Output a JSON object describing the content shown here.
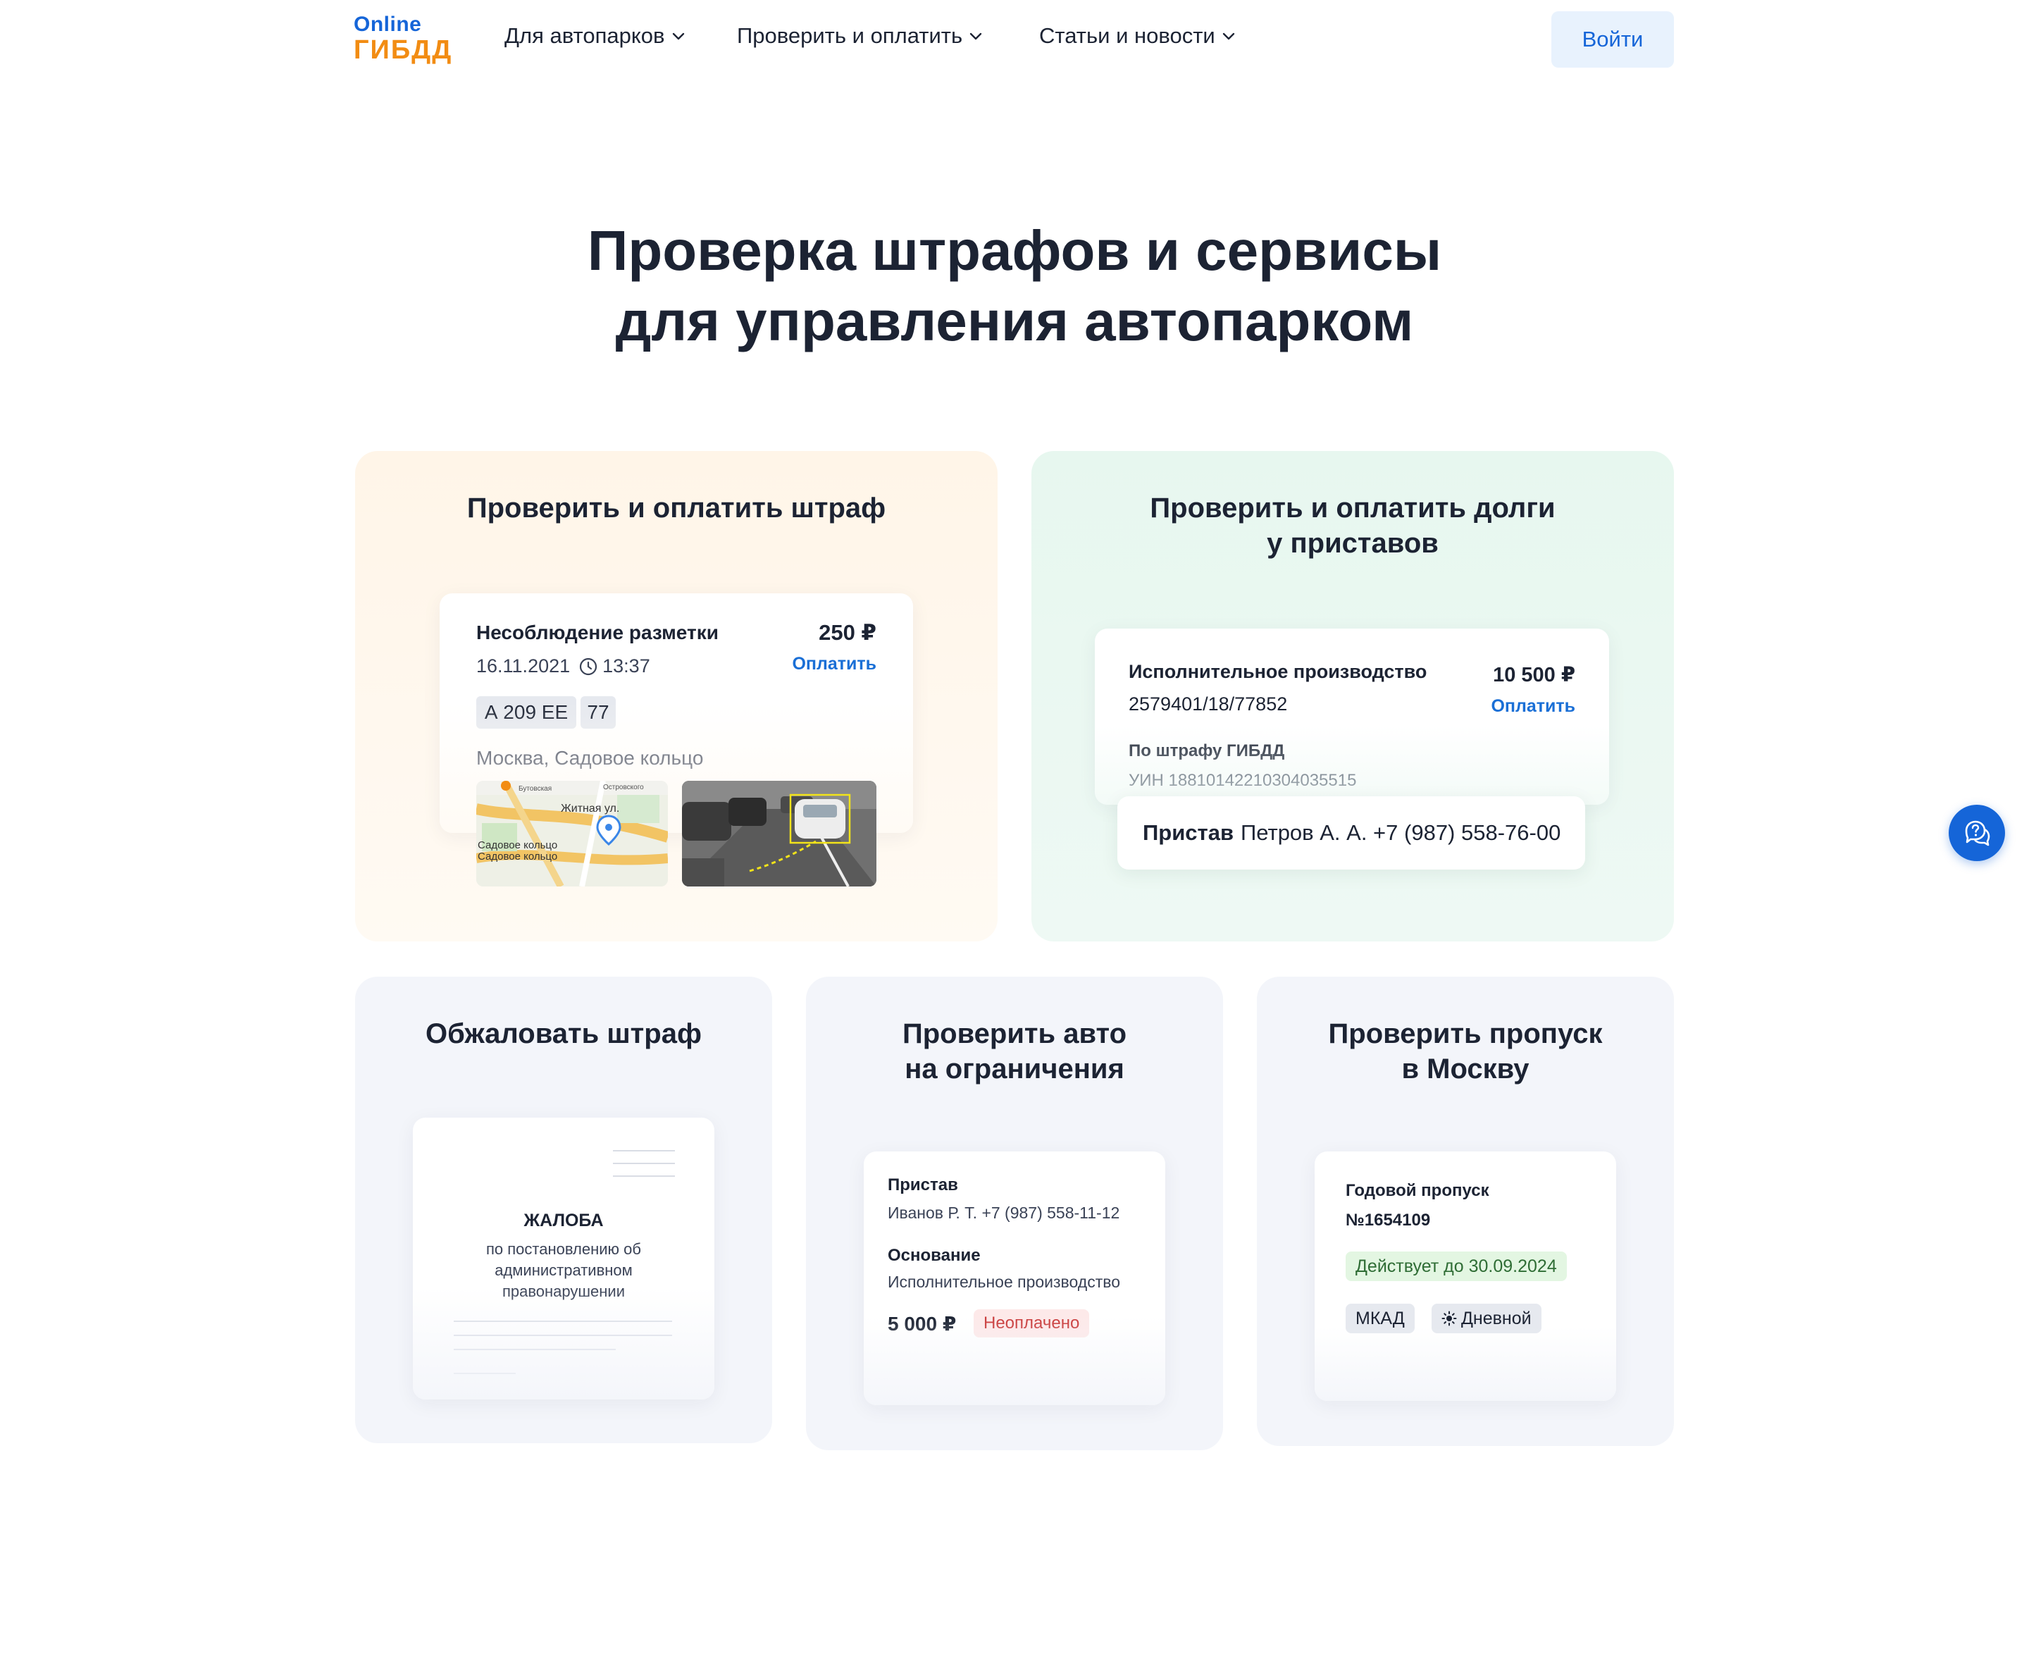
{
  "header": {
    "logo_top": "Online",
    "logo_bottom": "ГИБДД",
    "nav": [
      {
        "label": "Для автопарков"
      },
      {
        "label": "Проверить и оплатить"
      },
      {
        "label": "Статьи и новости"
      }
    ],
    "login_label": "Войти"
  },
  "hero": {
    "title_line1": "Проверка штрафов и сервисы",
    "title_line2": "для управления автопарком"
  },
  "fine_card": {
    "title": "Проверить и оплатить штраф",
    "violation": "Несоблюдение разметки",
    "amount": "250 ₽",
    "pay_label": "Оплатить",
    "date": "16.11.2021",
    "time": "13:37",
    "plate_number": "А 209 ЕЕ",
    "plate_region": "77",
    "location": "Москва, Садовое кольцо",
    "map_labels": {
      "street": "Житная ул.",
      "ring1": "Садовое кольцо",
      "ring2": "Садовое кольцо",
      "top_left": "Бутовская",
      "top_right": "Островского"
    }
  },
  "debt_card": {
    "title_line1": "Проверить и оплатить долги",
    "title_line2": "у приставов",
    "proceeding_label": "Исполнительное производство",
    "proceeding_number": "2579401/18/77852",
    "amount": "10 500 ₽",
    "pay_label": "Оплатить",
    "basis_label": "По штрафу ГИБДД",
    "uin": "УИН 18810142210304035515",
    "bailiff_label": "Пристав",
    "bailiff_info": "Петров А. А. +7 (987) 558-76-00"
  },
  "appeal_card": {
    "title": "Обжаловать штраф",
    "doc_title": "ЖАЛОБА",
    "doc_sub1": "по постановлению об",
    "doc_sub2": "административном",
    "doc_sub3": "правонарушении"
  },
  "restrict_card": {
    "title_line1": "Проверить авто",
    "title_line2": "на ограничения",
    "bailiff_label": "Пристав",
    "bailiff_info": "Иванов Р. Т. +7 (987) 558-11-12",
    "basis_label": "Основание",
    "basis_value": "Исполнительное производство",
    "amount": "5 000 ₽",
    "status": "Неоплачено"
  },
  "pass_card": {
    "title_line1": "Проверить пропуск",
    "title_line2": "в Москву",
    "pass_type": "Годовой пропуск",
    "pass_number": "№1654109",
    "valid_until": "Действует до 30.09.2024",
    "zone": "МКАД",
    "period": "Дневной"
  },
  "colors": {
    "accent": "#1565d8",
    "logo_orange": "#f28c13",
    "unpaid": "#c93a3a",
    "valid": "#2f6d35"
  },
  "icons": [
    "chevron-down-icon",
    "clock-icon",
    "map-pin-icon",
    "sun-icon",
    "support-chat-icon"
  ]
}
